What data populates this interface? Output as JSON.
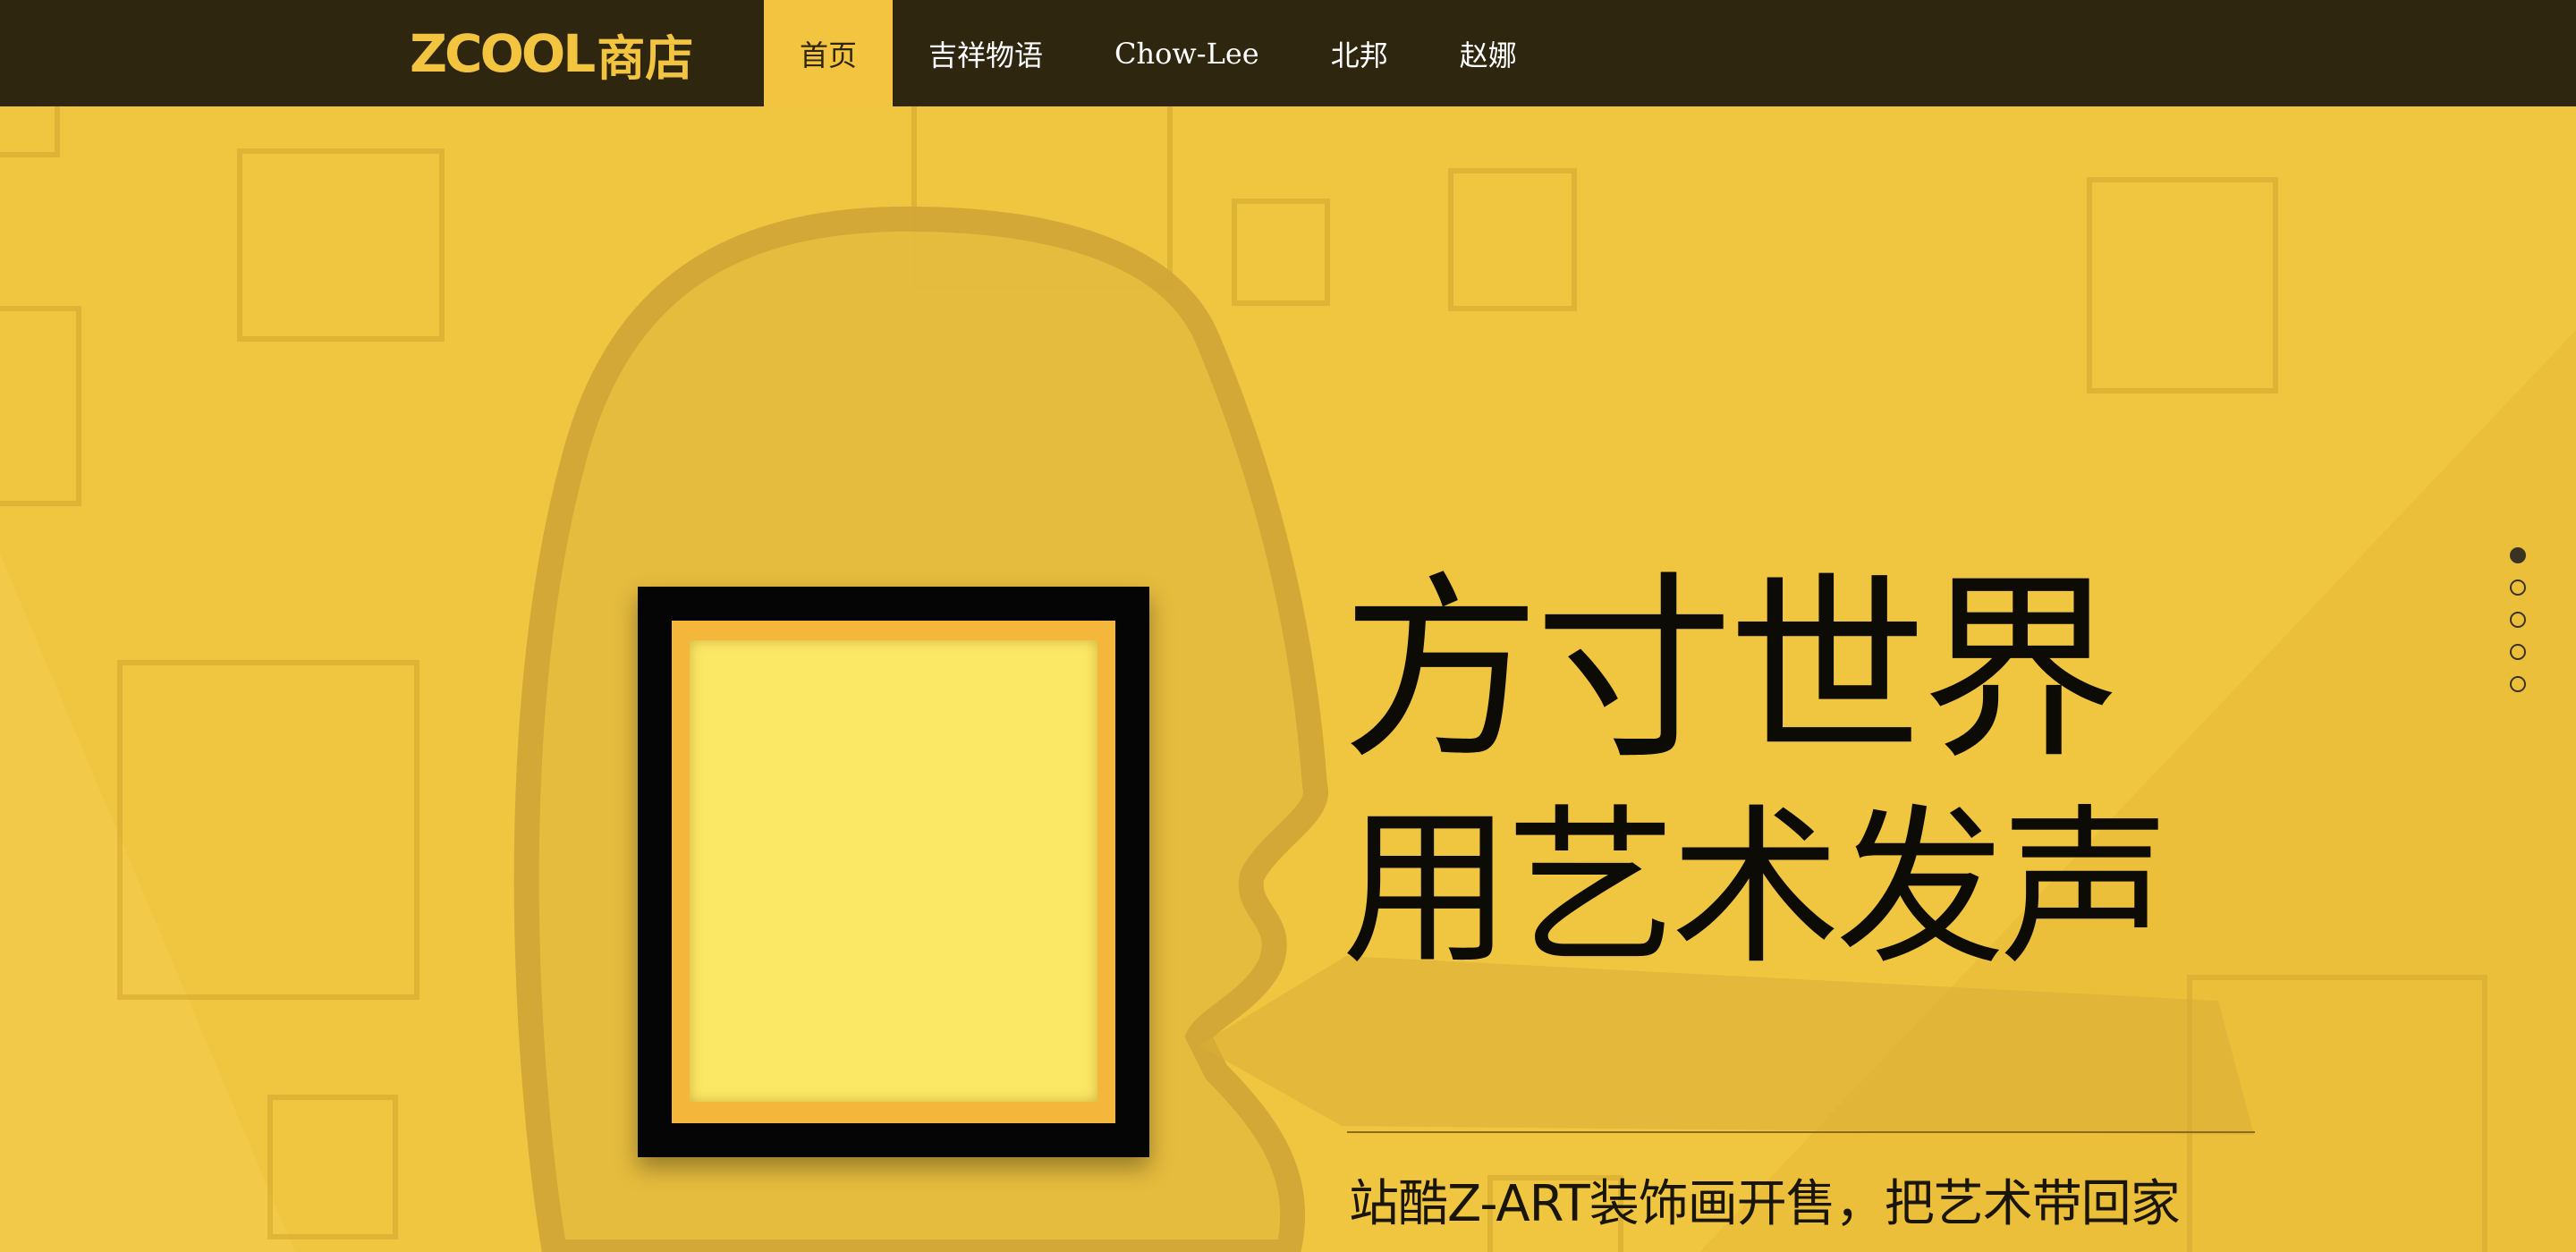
{
  "header": {
    "logo_wordmark": "ZCOOL",
    "logo_store": "商店",
    "nav": [
      {
        "label": "首页",
        "active": true
      },
      {
        "label": "吉祥物语",
        "active": false
      },
      {
        "label": "Chow-Lee",
        "active": false
      },
      {
        "label": "北邦",
        "active": false
      },
      {
        "label": "赵娜",
        "active": false
      }
    ]
  },
  "hero": {
    "headline_line1": "方寸世界",
    "headline_line2": "用艺术发声",
    "tagline": "站酷Z-ART装饰画开售，把艺术带回家"
  },
  "carousel": {
    "slide_count": 5,
    "active_index": 0
  },
  "colors": {
    "topbar": "#2f2610",
    "accent": "#f3c43f",
    "hero_bg": "#f0c641",
    "text_dark": "#0d0b05"
  }
}
